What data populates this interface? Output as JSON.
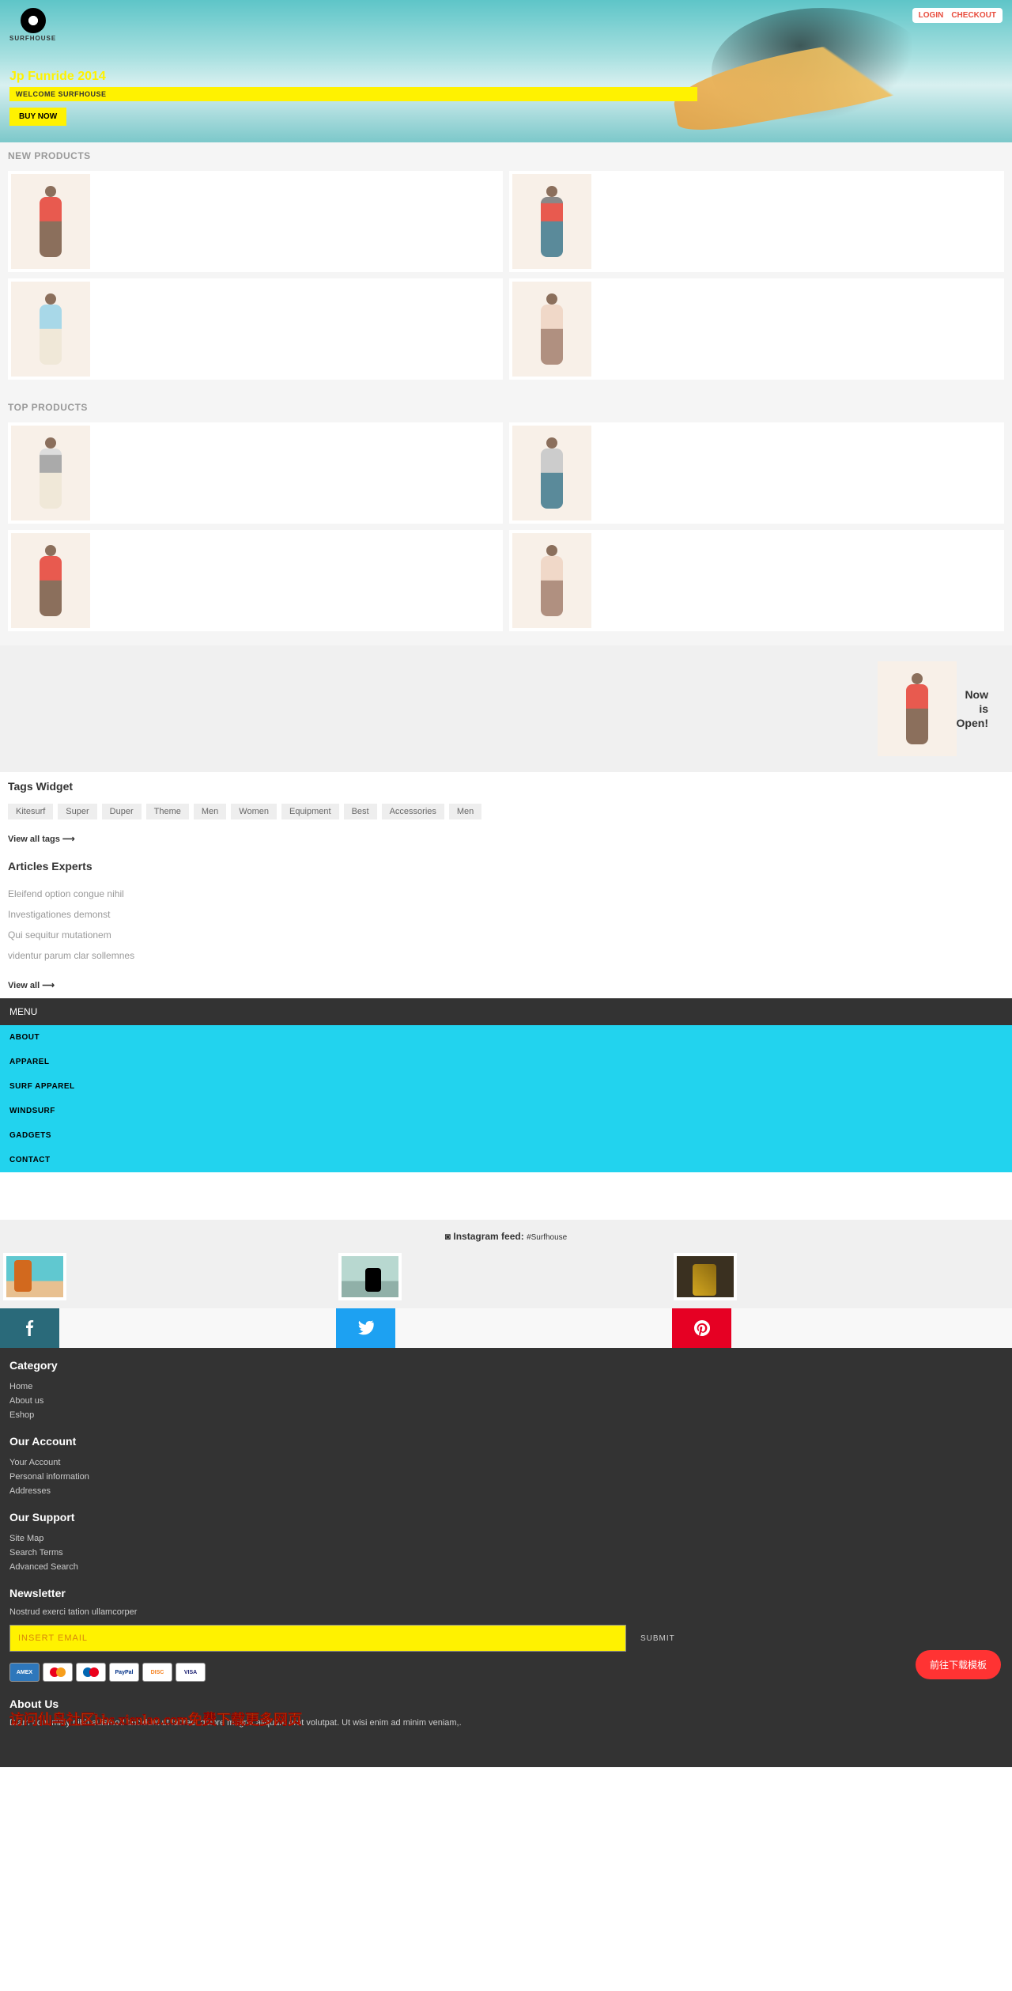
{
  "logo_text": "SURFHOUSE",
  "topbar": {
    "login": "LOGIN",
    "checkout": "CHECKOUT"
  },
  "hero": {
    "title": "Jp Funride 2014",
    "welcome": "WELCOME SURFHOUSE",
    "cta": "BUY NOW"
  },
  "sections": {
    "new_products": "NEW PRODUCTS",
    "top_products": "TOP PRODUCTS"
  },
  "feature": {
    "line1": "Now",
    "line2": "is",
    "line3": "Open!"
  },
  "tags_widget": {
    "title": "Tags Widget",
    "tags": [
      "Kitesurf",
      "Super",
      "Duper",
      "Theme",
      "Men",
      "Women",
      "Equipment",
      "Best",
      "Accessories",
      "Men"
    ],
    "view_all": "View all tags ⟶"
  },
  "articles": {
    "title": "Articles Experts",
    "items": [
      "Eleifend option congue nihil",
      "Investigationes demonst",
      "Qui sequitur mutationem",
      "videntur parum clar sollemnes"
    ],
    "view_all": "View all ⟶"
  },
  "menu": {
    "label": "MENU",
    "items": [
      "ABOUT",
      "APPAREL",
      "SURF APPAREL",
      "WINDSURF",
      "GADGETS",
      "CONTACT"
    ]
  },
  "instagram": {
    "label": "Instagram feed: ",
    "tag": "#Surfhouse"
  },
  "footer": {
    "category": {
      "title": "Category",
      "items": [
        "Home",
        "About us",
        "Eshop"
      ]
    },
    "account": {
      "title": "Our Account",
      "items": [
        "Your Account",
        "Personal information",
        "Addresses"
      ]
    },
    "support": {
      "title": "Our Support",
      "items": [
        "Site Map",
        "Search Terms",
        "Advanced Search"
      ]
    },
    "newsletter": {
      "title": "Newsletter",
      "desc": "Nostrud exerci tation ullamcorper",
      "placeholder": "INSERT EMAIL",
      "submit": "SUBMIT"
    },
    "about": {
      "title": "About Us",
      "desc": "Diam nonummy nibh euismod tincidunt ut laoreet dolore magna aliquam erat volutpat. Ut wisi enim ad minim veniam,."
    }
  },
  "floating_btn": "前往下载模板",
  "watermark": "访问仙鸟社区bbs.xienlao.com免费下载更多网页"
}
